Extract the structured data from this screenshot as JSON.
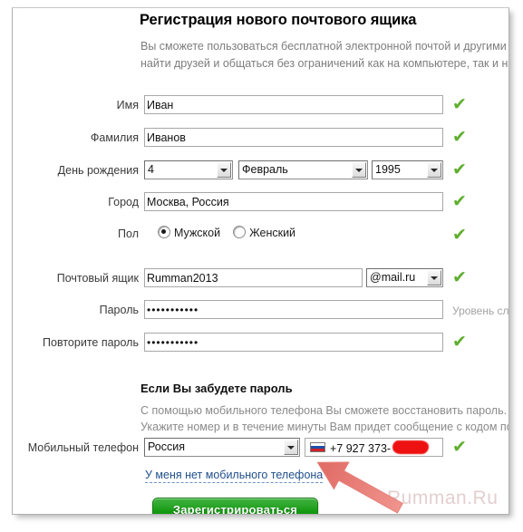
{
  "header": {
    "title": "Регистрация нового почтового ящика",
    "desc_line1": "Вы сможете пользоваться бесплатной электронной почтой и другими п",
    "desc_line2": "найти друзей и общаться без ограничений как на компьютере, так и на"
  },
  "fields": {
    "first_name": {
      "label": "Имя",
      "value": "Иван",
      "valid": true
    },
    "last_name": {
      "label": "Фамилия",
      "value": "Иванов",
      "valid": true
    },
    "birthday": {
      "label": "День рождения",
      "day": "4",
      "month": "Февраль",
      "year": "1995",
      "valid": true
    },
    "city": {
      "label": "Город",
      "value": "Москва, Россия",
      "valid": true
    },
    "gender": {
      "label": "Пол",
      "male_label": "Мужской",
      "female_label": "Женский",
      "selected": "male",
      "valid": true
    },
    "mailbox": {
      "label": "Почтовый ящик",
      "value": "Rumman2013",
      "domain": "@mail.ru",
      "valid": true
    },
    "password": {
      "label": "Пароль",
      "value": "•••••••••••",
      "strength_hint": "Уровень сложн"
    },
    "password_repeat": {
      "label": "Повторите пароль",
      "value": "•••••••••••",
      "valid": true
    },
    "mobile": {
      "label": "Мобильный телефон",
      "country": "Россия",
      "number": "+7 927 373-",
      "flag": "ru-flag-icon",
      "valid": true
    }
  },
  "recovery": {
    "title": "Если Вы забудете пароль",
    "line1": "С помощью мобильного телефона Вы сможете восстановить пароль.",
    "line2": "Укажите номер и в течение минуты Вам придет сообщение с кодом под"
  },
  "no_phone_link": "У меня нет мобильного телефона",
  "submit_button": "Зарегистрироваться",
  "watermark": "Rumman.Ru",
  "icons": {
    "check": "✔",
    "dropdown": "chevron-down-icon",
    "arrow": "pointer-arrow-icon"
  },
  "colors": {
    "check_green": "#5fae2e",
    "button_green": "#159a12",
    "link_blue": "#21508c",
    "arrow_red": "#e8736e",
    "watermark": "#e4cfd0"
  }
}
